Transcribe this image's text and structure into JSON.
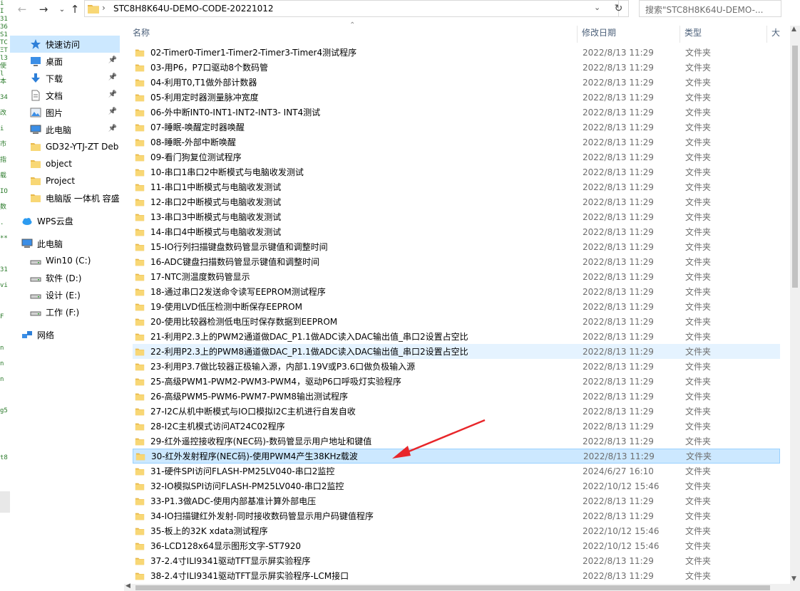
{
  "code_strip_lines": [
    "i",
    "I",
    "31",
    "36",
    "S1",
    "TC",
    "ΞT",
    "l3",
    "使",
    "l",
    "本",
    "34",
    "改",
    "i",
    "市",
    "指",
    "载",
    "IO",
    "数",
    ".",
    "**",
    "",
    "31",
    "vi",
    "",
    "F",
    "",
    "n",
    "n",
    "n",
    "",
    "g5",
    "",
    "",
    "t8"
  ],
  "address_bar": {
    "path": "STC8H8K64U-DEMO-CODE-20221012",
    "search_placeholder": "搜索\"STC8H8K64U-DEMO-..."
  },
  "nav_pane": {
    "items": [
      {
        "label": "快速访问",
        "icon": "star-icon",
        "pinned": false
      },
      {
        "label": "桌面",
        "icon": "desktop-icon",
        "pinned": true
      },
      {
        "label": "下载",
        "icon": "download-icon",
        "pinned": true
      },
      {
        "label": "文档",
        "icon": "document-icon",
        "pinned": true
      },
      {
        "label": "图片",
        "icon": "picture-icon",
        "pinned": true
      },
      {
        "label": "此电脑",
        "icon": "computer-icon",
        "pinned": true
      },
      {
        "label": "GD32-YTJ-ZT Deb",
        "icon": "folder-icon",
        "pinned": false
      },
      {
        "label": "object",
        "icon": "folder-icon",
        "pinned": false
      },
      {
        "label": "Project",
        "icon": "folder-icon",
        "pinned": false
      },
      {
        "label": "电脑版 一体机 容盛",
        "icon": "folder-icon",
        "pinned": false
      },
      {
        "label": "WPS云盘",
        "icon": "cloud-icon",
        "pinned": false
      },
      {
        "label": "此电脑",
        "icon": "computer-icon",
        "pinned": false
      },
      {
        "label": "Win10 (C:)",
        "icon": "drive-icon",
        "pinned": false
      },
      {
        "label": "软件 (D:)",
        "icon": "drive-icon",
        "pinned": false
      },
      {
        "label": "设计 (E:)",
        "icon": "drive-icon",
        "pinned": false
      },
      {
        "label": "工作 (F:)",
        "icon": "drive-icon",
        "pinned": false
      },
      {
        "label": "网络",
        "icon": "network-icon",
        "pinned": false
      }
    ]
  },
  "columns": {
    "name": "名称",
    "date": "修改日期",
    "type": "类型",
    "size": "大"
  },
  "files": [
    {
      "name": "02-Timer0-Timer1-Timer2-Timer3-Timer4测试程序",
      "date": "2022/8/13 11:29",
      "type": "文件夹"
    },
    {
      "name": "03-用P6，P7口驱动8个数码管",
      "date": "2022/8/13 11:29",
      "type": "文件夹"
    },
    {
      "name": "04-利用T0,T1做外部计数器",
      "date": "2022/8/13 11:29",
      "type": "文件夹"
    },
    {
      "name": "05-利用定时器测量脉冲宽度",
      "date": "2022/8/13 11:29",
      "type": "文件夹"
    },
    {
      "name": "06-外中断INT0-INT1-INT2-INT3- INT4测试",
      "date": "2022/8/13 11:29",
      "type": "文件夹"
    },
    {
      "name": "07-睡眠-唤醒定时器唤醒",
      "date": "2022/8/13 11:29",
      "type": "文件夹"
    },
    {
      "name": "08-睡眠-外部中断唤醒",
      "date": "2022/8/13 11:29",
      "type": "文件夹"
    },
    {
      "name": "09-看门狗复位测试程序",
      "date": "2022/8/13 11:29",
      "type": "文件夹"
    },
    {
      "name": "10-串口1串口2中断模式与电脑收发测试",
      "date": "2022/8/13 11:29",
      "type": "文件夹"
    },
    {
      "name": "11-串口1中断模式与电脑收发测试",
      "date": "2022/8/13 11:29",
      "type": "文件夹"
    },
    {
      "name": "12-串口2中断模式与电脑收发测试",
      "date": "2022/8/13 11:29",
      "type": "文件夹"
    },
    {
      "name": "13-串口3中断模式与电脑收发测试",
      "date": "2022/8/13 11:29",
      "type": "文件夹"
    },
    {
      "name": "14-串口4中断模式与电脑收发测试",
      "date": "2022/8/13 11:29",
      "type": "文件夹"
    },
    {
      "name": "15-IO行列扫描键盘数码管显示键值和调整时间",
      "date": "2022/8/13 11:29",
      "type": "文件夹"
    },
    {
      "name": "16-ADC键盘扫描数码管显示键值和调整时间",
      "date": "2022/8/13 11:29",
      "type": "文件夹"
    },
    {
      "name": "17-NTC测温度数码管显示",
      "date": "2022/8/13 11:29",
      "type": "文件夹"
    },
    {
      "name": "18-通过串口2发送命令读写EEPROM测试程序",
      "date": "2022/8/13 11:29",
      "type": "文件夹"
    },
    {
      "name": "19-使用LVD低压检测中断保存EEPROM",
      "date": "2022/8/13 11:29",
      "type": "文件夹"
    },
    {
      "name": "20-使用比较器检测低电压时保存数据到EEPROM",
      "date": "2022/8/13 11:29",
      "type": "文件夹"
    },
    {
      "name": "21-利用P2.3上的PWM2通道做DAC_P1.1做ADC读入DAC输出值_串口2设置占空比",
      "date": "2022/8/13 11:29",
      "type": "文件夹"
    },
    {
      "name": "22-利用P2.3上的PWM8通道做DAC_P1.1做ADC读入DAC输出值_串口2设置占空比",
      "date": "2022/8/13 11:29",
      "type": "文件夹",
      "state": "hover"
    },
    {
      "name": "23-利用P3.7做比较器正极输入源，内部1.19V或P3.6口做负极输入源",
      "date": "2022/8/13 11:29",
      "type": "文件夹"
    },
    {
      "name": "25-高级PWM1-PWM2-PWM3-PWM4，驱动P6口呼吸灯实验程序",
      "date": "2022/8/13 11:29",
      "type": "文件夹"
    },
    {
      "name": "26-高级PWM5-PWM6-PWM7-PWM8输出测试程序",
      "date": "2022/8/13 11:29",
      "type": "文件夹"
    },
    {
      "name": "27-I2C从机中断模式与IO口模拟I2C主机进行自发自收",
      "date": "2022/8/13 11:29",
      "type": "文件夹"
    },
    {
      "name": "28-I2C主机模式访问AT24C02程序",
      "date": "2022/8/13 11:29",
      "type": "文件夹"
    },
    {
      "name": "29-红外遥控接收程序(NEC码)-数码管显示用户地址和键值",
      "date": "2022/8/13 11:29",
      "type": "文件夹"
    },
    {
      "name": "30-红外发射程序(NEC码)-使用PWM4产生38KHz载波",
      "date": "2022/8/13 11:29",
      "type": "文件夹",
      "state": "selected"
    },
    {
      "name": "31-硬件SPI访问FLASH-PM25LV040-串口2监控",
      "date": "2024/6/27 16:10",
      "type": "文件夹"
    },
    {
      "name": "32-IO模拟SPI访问FLASH-PM25LV040-串口2监控",
      "date": "2022/10/12 15:46",
      "type": "文件夹"
    },
    {
      "name": "33-P1.3做ADC-使用内部基准计算外部电压",
      "date": "2022/8/13 11:29",
      "type": "文件夹"
    },
    {
      "name": "34-IO扫描键红外发射-同时接收数码管显示用户码键值程序",
      "date": "2022/8/13 11:29",
      "type": "文件夹"
    },
    {
      "name": "35-板上的32K xdata测试程序",
      "date": "2022/10/12 15:46",
      "type": "文件夹"
    },
    {
      "name": "36-LCD128x64显示图形文字-ST7920",
      "date": "2022/10/12 15:46",
      "type": "文件夹"
    },
    {
      "name": "37-2.4寸ILI9341驱动TFT显示屏实验程序",
      "date": "2022/8/13 11:29",
      "type": "文件夹"
    },
    {
      "name": "38-2.4寸ILI9341驱动TFT显示屏实验程序-LCM接口",
      "date": "2022/8/13 11:29",
      "type": "文件夹"
    }
  ],
  "colors": {
    "selected_bg": "#cce8ff",
    "hover_bg": "#e5f3ff",
    "folder": "#f8d775",
    "arrow": "#e8262a"
  }
}
